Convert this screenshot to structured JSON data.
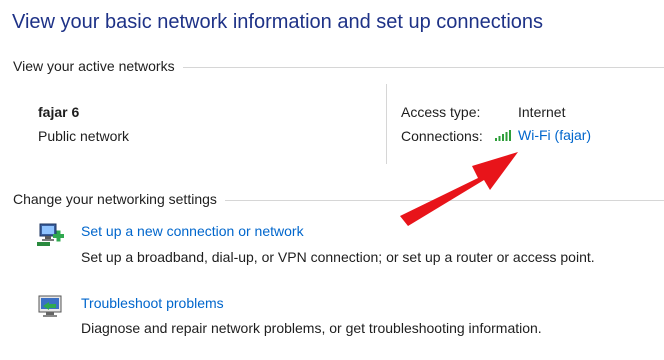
{
  "page": {
    "title": "View your basic network information and set up connections"
  },
  "active_networks": {
    "header": "View your active networks",
    "network": {
      "name": "fajar 6",
      "category": "Public network"
    },
    "access_type_label": "Access type:",
    "access_type_value": "Internet",
    "connections_label": "Connections:",
    "connection_link": "Wi-Fi (fajar)",
    "connection_icon": "wifi-signal-icon"
  },
  "settings": {
    "header": "Change your networking settings",
    "tasks": [
      {
        "icon": "new-connection-icon",
        "link": "Set up a new connection or network",
        "description": "Set up a broadband, dial-up, or VPN connection; or set up a router or access point."
      },
      {
        "icon": "troubleshoot-icon",
        "link": "Troubleshoot problems",
        "description": "Diagnose and repair network problems, or get troubleshooting information."
      }
    ]
  },
  "annotation": {
    "arrow_color": "#e8141a"
  }
}
